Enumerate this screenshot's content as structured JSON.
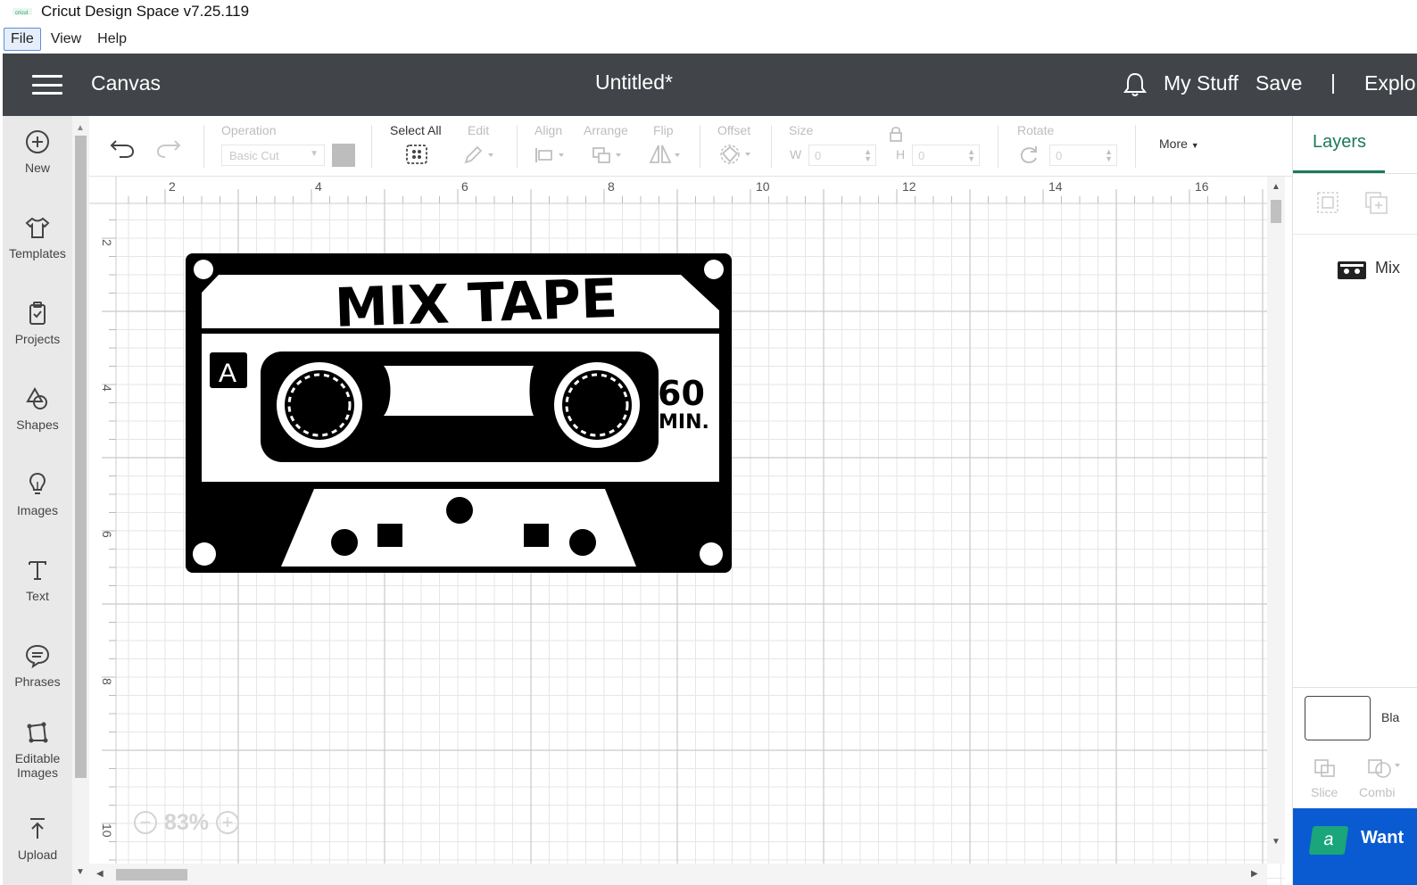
{
  "window": {
    "title": "Cricut Design Space  v7.25.119"
  },
  "menu": {
    "items": [
      "File",
      "View",
      "Help"
    ]
  },
  "header": {
    "section": "Canvas",
    "document_title": "Untitled*",
    "my_stuff": "My Stuff",
    "save": "Save",
    "separator": "|",
    "explore": "Explor"
  },
  "sidebar": {
    "items": [
      {
        "label": "New",
        "icon": "plus-circle-icon"
      },
      {
        "label": "Templates",
        "icon": "tshirt-icon"
      },
      {
        "label": "Projects",
        "icon": "clipboard-icon"
      },
      {
        "label": "Shapes",
        "icon": "shapes-icon"
      },
      {
        "label": "Images",
        "icon": "lightbulb-icon"
      },
      {
        "label": "Text",
        "icon": "text-t-icon"
      },
      {
        "label": "Phrases",
        "icon": "speech-bubble-icon"
      },
      {
        "label": "Editable",
        "label2": "Images",
        "icon": "editable-images-icon"
      },
      {
        "label": "Upload",
        "icon": "upload-icon"
      }
    ]
  },
  "toolbar": {
    "operation_label": "Operation",
    "operation_value": "Basic Cut",
    "select_all": "Select All",
    "edit": "Edit",
    "align": "Align",
    "arrange": "Arrange",
    "flip": "Flip",
    "offset": "Offset",
    "size": "Size",
    "w_label": "W",
    "h_label": "H",
    "w_value": "0",
    "h_value": "0",
    "rotate": "Rotate",
    "rotate_value": "0",
    "more": "More"
  },
  "ruler": {
    "x_labels": [
      "2",
      "4",
      "6",
      "8",
      "10",
      "12",
      "14",
      "16"
    ],
    "y_labels": [
      "2",
      "4",
      "6",
      "8",
      "10"
    ]
  },
  "design": {
    "title_text": "MIX TAPE",
    "side_letter": "A",
    "duration_num": "60",
    "duration_unit": "MIN."
  },
  "zoom": {
    "value": "83%",
    "minus": "−",
    "plus": "+"
  },
  "right_panel": {
    "tab_layers": "Layers",
    "layer_name": "Mix",
    "blank_label": "Bla",
    "slice": "Slice",
    "combine": "Combi",
    "cta_badge": "a",
    "cta_text": "Want"
  },
  "colors": {
    "header_bg": "#414549",
    "accent_green": "#1a7a5c",
    "cta_blue": "#0a5bd1"
  }
}
